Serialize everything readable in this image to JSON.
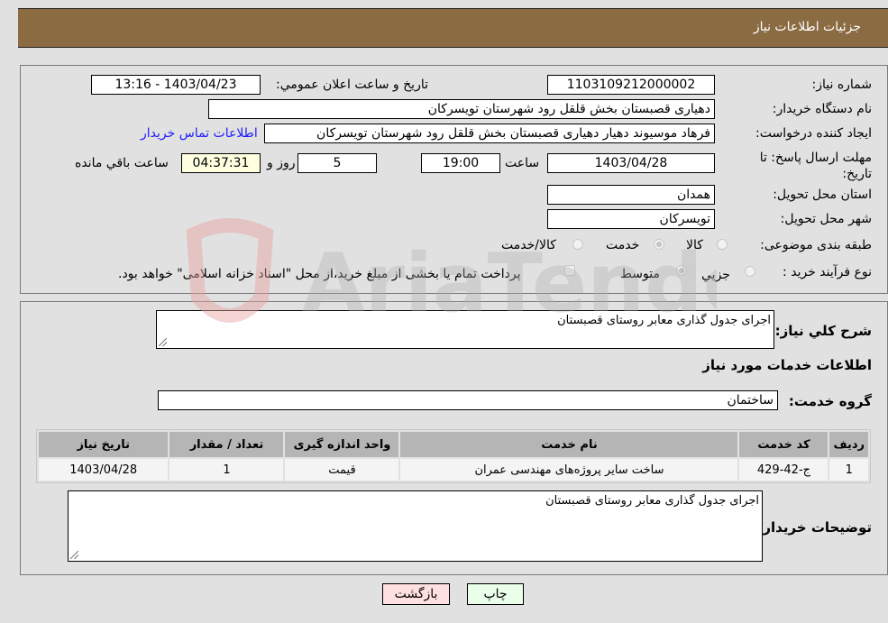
{
  "header": {
    "title": "جزئیات اطلاعات نیاز"
  },
  "info": {
    "need_number_label": "شماره نیاز:",
    "need_number": "1103109212000002",
    "announce_label": "تاریخ و ساعت اعلان عمومي:",
    "announce_value": "1403/04/23 - 13:16",
    "buyer_org_label": "نام دستگاه خریدار:",
    "buyer_org": "دهیاری قصبستان بخش قلقل رود شهرستان تویسرکان",
    "creator_label": "ایجاد کننده درخواست:",
    "creator": "فرهاد موسیوند دهیار دهیاری قصبستان بخش قلقل رود شهرستان تویسرکان",
    "contact_link": "اطلاعات تماس خریدار",
    "deadline_label": "مهلت ارسال پاسخ: تا تاریخ:",
    "deadline_date": "1403/04/28",
    "time_label": "ساعت",
    "deadline_time": "19:00",
    "days": "5",
    "days_label": "روز و",
    "remaining_time": "04:37:31",
    "remaining_label": "ساعت باقي مانده",
    "province_label": "استان محل تحویل:",
    "province": "همدان",
    "city_label": "شهر محل تحویل:",
    "city": "تویسرکان",
    "category_label": "طبقه بندی موضوعی:",
    "category_options": [
      {
        "label": "کالا",
        "selected": false
      },
      {
        "label": "خدمت",
        "selected": true
      },
      {
        "label": "کالا/خدمت",
        "selected": false
      }
    ],
    "process_label": "نوع فرآیند خرید :",
    "process_options": [
      {
        "label": "جزيي",
        "selected": false
      },
      {
        "label": "متوسط",
        "selected": true
      }
    ],
    "treasury_note": "پرداخت تمام یا بخشی از مبلغ خرید،از محل \"اسناد خزانه اسلامی\" خواهد بود.",
    "treasury_checked": false
  },
  "details": {
    "general_desc_label": "شرح کلي نیاز:",
    "general_desc": "اجرای جدول گذاری معابر روستای قصبستان",
    "services_title": "اطلاعات خدمات مورد نیاز",
    "service_group_label": "گروه خدمت:",
    "service_group": "ساختمان",
    "table": {
      "headers": [
        "ردیف",
        "کد خدمت",
        "نام خدمت",
        "واحد اندازه گیری",
        "تعداد / مقدار",
        "تاریخ نیاز"
      ],
      "rows": [
        [
          "1",
          "ج-42-429",
          "ساخت سایر پروژه‌های مهندسی عمران",
          "قیمت",
          "1",
          "1403/04/28"
        ]
      ]
    },
    "buyer_notes_label": "توضیحات خریدار:",
    "buyer_notes": "اجرای جدول گذاری معابر روستای قصبستان"
  },
  "buttons": {
    "print": "چاپ",
    "back": "بازگشت"
  },
  "colors": {
    "header_bg": "#8b6b42",
    "print_bg": "#eaffea",
    "back_bg": "#ffe0e0",
    "link": "#1a1aff"
  }
}
